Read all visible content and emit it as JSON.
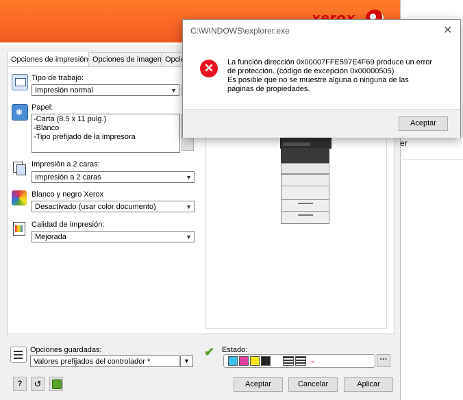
{
  "brand": {
    "logo_text": "xerox"
  },
  "tabs": [
    "Opciones de impresión",
    "Opciones de imagen",
    "Opcio"
  ],
  "job_type": {
    "label": "Tipo de trabajo:",
    "value": "Impresión normal"
  },
  "paper": {
    "label": "Papel:",
    "lines": [
      "-Carta (8.5 x 11 pulg.)",
      "-Blanco",
      "-Tipo prefijado de la impresora"
    ]
  },
  "duplex": {
    "label": "Impresión a 2 caras:",
    "value": "Impresión a 2 caras"
  },
  "bw": {
    "label": "Blanco y negro Xerox",
    "value": "Desactivado (usar color documento)"
  },
  "quality": {
    "label": "Calidad de impresión:",
    "value": "Mejorada"
  },
  "saved": {
    "label": "Opciones guardadas:",
    "value": "Valores prefijados del controlador *"
  },
  "status": {
    "label": "Estado:"
  },
  "buttons": {
    "help": "?",
    "ok": "Aceptar",
    "cancel": "Cancelar",
    "apply": "Aplicar"
  },
  "error": {
    "title": "C:\\WINDOWS\\explorer.exe",
    "line1": "La función dirección 0x00007FFE597E4F69 produce un error",
    "line2": "de protección. (código de excepción 0x00000505)",
    "line3": "Es posible que no se muestre alguna o ninguna de las",
    "line4": "páginas de propiedades.",
    "ok": "Aceptar"
  },
  "bg_fragment": "er",
  "colors": {
    "brand_orange": "#f15a22",
    "error_red": "#e81123",
    "accent_green": "#5aa02c"
  }
}
